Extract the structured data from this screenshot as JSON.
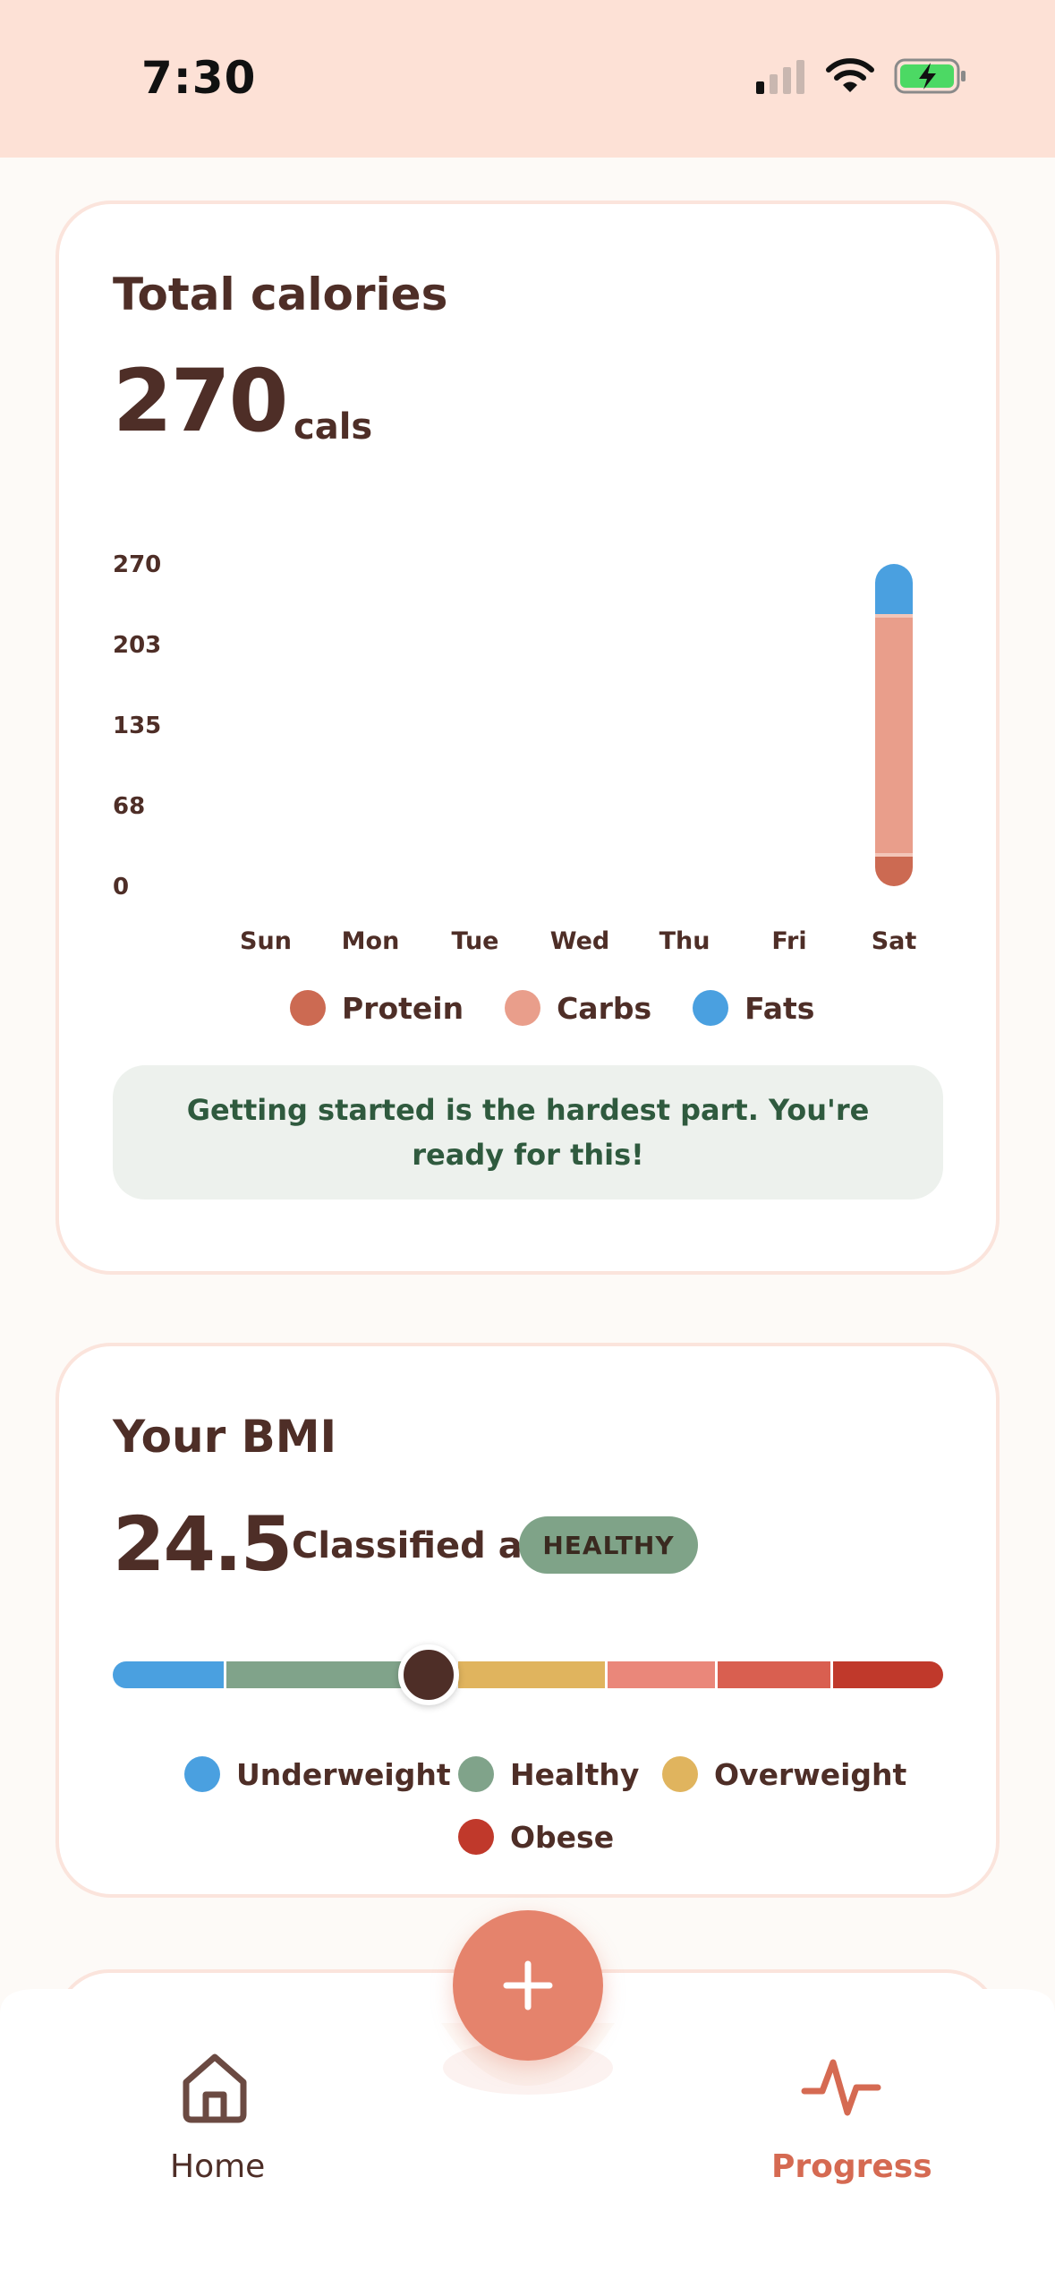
{
  "status_bar": {
    "time": "7:30"
  },
  "calories_card": {
    "title": "Total calories",
    "value": "270",
    "unit": "cals",
    "tip": "Getting started is the hardest part. You're ready for this!"
  },
  "chart_data": {
    "type": "bar",
    "stacked": true,
    "categories": [
      "Sun",
      "Mon",
      "Tue",
      "Wed",
      "Thu",
      "Fri",
      "Sat"
    ],
    "y_ticks": [
      "270",
      "203",
      "135",
      "68",
      "0"
    ],
    "ylim": [
      0,
      270
    ],
    "series": [
      {
        "name": "Protein",
        "color": "#cc6a52",
        "values": [
          0,
          0,
          0,
          0,
          0,
          0,
          28
        ]
      },
      {
        "name": "Carbs",
        "color": "#e99e8b",
        "values": [
          0,
          0,
          0,
          0,
          0,
          0,
          200
        ]
      },
      {
        "name": "Fats",
        "color": "#4aa0e0",
        "values": [
          0,
          0,
          0,
          0,
          0,
          0,
          42
        ]
      }
    ],
    "legend_position": "bottom",
    "grid": false
  },
  "bmi_card": {
    "title": "Your BMI",
    "value": "24.5",
    "classified_label": "Classified as",
    "badge": "HEALTHY",
    "marker_fraction": 0.38,
    "segments": [
      {
        "color": "#4aa0e0",
        "fraction": 0.137
      },
      {
        "color": "#80a38a",
        "fraction": 0.279
      },
      {
        "color": "#e0b45e",
        "fraction": 0.18
      },
      {
        "color": "#ea877a",
        "fraction": 0.132
      },
      {
        "color": "#d95f50",
        "fraction": 0.14
      },
      {
        "color": "#c0392b",
        "fraction": 0.132
      }
    ],
    "legend": [
      {
        "label": "Underweight",
        "color": "#4aa0e0"
      },
      {
        "label": "Healthy",
        "color": "#80a38a"
      },
      {
        "label": "Overweight",
        "color": "#e0b45e"
      },
      {
        "label": "Obese",
        "color": "#c0392b"
      }
    ]
  },
  "bottom_nav": {
    "home_label": "Home",
    "progress_label": "Progress",
    "active": "Progress"
  },
  "colors": {
    "brand_dark": "#4e2e27",
    "accent": "#d56a52",
    "fab": "#e5836c"
  }
}
